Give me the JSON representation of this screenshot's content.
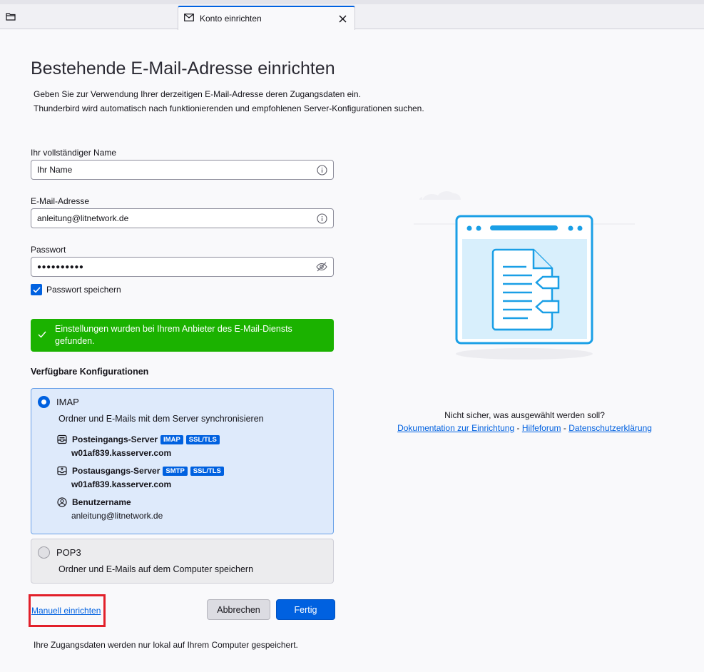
{
  "tabbar": {
    "tab_title": "Konto einrichten"
  },
  "page": {
    "title": "Bestehende E-Mail-Adresse einrichten",
    "intro_line1": "Geben Sie zur Verwendung Ihrer derzeitigen E-Mail-Adresse deren Zugangsdaten ein.",
    "intro_line2": "Thunderbird wird automatisch nach funktionierenden und empfohlenen Server-Konfigurationen suchen."
  },
  "form": {
    "name_label": "Ihr vollständiger Name",
    "name_value": "Ihr Name",
    "email_label": "E-Mail-Adresse",
    "email_value": "anleitung@litnetwork.de",
    "password_label": "Passwort",
    "password_value": "●●●●●●●●●●",
    "remember_label": "Passwort speichern",
    "remember_checked": true
  },
  "status": {
    "message": "Einstellungen wurden bei Ihrem Anbieter des E-Mail-Diensts gefunden.",
    "color": "#1bb200"
  },
  "configs": {
    "heading": "Verfügbare Konfigurationen",
    "imap": {
      "label": "IMAP",
      "selected": true,
      "description": "Ordner und E-Mails mit dem Server synchronisieren",
      "incoming_label": "Posteingangs-Server",
      "incoming_badge1": "IMAP",
      "incoming_badge2": "SSL/TLS",
      "incoming_host": "w01af839.kasserver.com",
      "outgoing_label": "Postausgangs-Server",
      "outgoing_badge1": "SMTP",
      "outgoing_badge2": "SSL/TLS",
      "outgoing_host": "w01af839.kasserver.com",
      "username_label": "Benutzername",
      "username_value": "anleitung@litnetwork.de"
    },
    "pop3": {
      "label": "POP3",
      "selected": false,
      "description": "Ordner und E-Mails auf dem Computer speichern"
    }
  },
  "actions": {
    "manual_link": "Manuell einrichten",
    "cancel_label": "Abbrechen",
    "done_label": "Fertig"
  },
  "footer": {
    "note": "Ihre Zugangsdaten werden nur lokal auf Ihrem Computer gespeichert."
  },
  "help": {
    "question": "Nicht sicher, was ausgewählt werden soll?",
    "link_docs": "Dokumentation zur Einrichtung",
    "link_forum": "Hilfeforum",
    "link_privacy": "Datenschutzerklärung",
    "separator": " - "
  },
  "colors": {
    "accent": "#0061e0",
    "highlight_box": "#e2202a"
  }
}
